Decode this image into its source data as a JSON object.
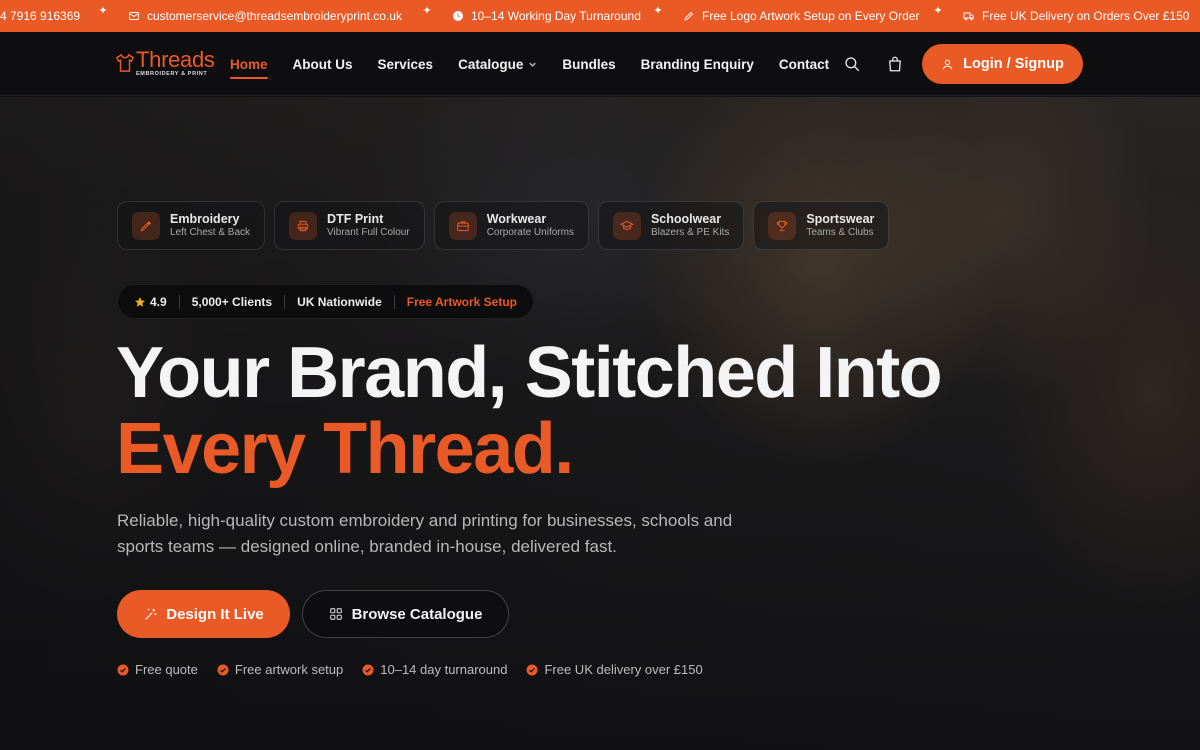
{
  "announcements": {
    "phone": "4 7916 916369",
    "email": "customerservice@threadsembroideryprint.co.uk",
    "turnaround": "10–14 Working Day Turnaround",
    "logo_setup": "Free Logo Artwork Setup on Every Order",
    "delivery": "Free UK Delivery on Orders Over £150",
    "sparkle": "✦"
  },
  "logo": {
    "main": "Threads",
    "sub": "EMBROIDERY & PRINT"
  },
  "nav": {
    "items": [
      {
        "label": "Home",
        "active": true
      },
      {
        "label": "About Us"
      },
      {
        "label": "Services"
      },
      {
        "label": "Catalogue",
        "has_dropdown": true
      },
      {
        "label": "Bundles"
      },
      {
        "label": "Branding Enquiry"
      },
      {
        "label": "Contact"
      }
    ],
    "login_label": "Login / Signup"
  },
  "services": [
    {
      "title": "Embroidery",
      "subtitle": "Left Chest & Back",
      "icon": "needle-icon"
    },
    {
      "title": "DTF Print",
      "subtitle": "Vibrant Full Colour",
      "icon": "printer-icon"
    },
    {
      "title": "Workwear",
      "subtitle": "Corporate Uniforms",
      "icon": "briefcase-icon"
    },
    {
      "title": "Schoolwear",
      "subtitle": "Blazers & PE Kits",
      "icon": "graduation-cap-icon"
    },
    {
      "title": "Sportswear",
      "subtitle": "Teams & Clubs",
      "icon": "trophy-icon"
    }
  ],
  "stats": {
    "rating": "4.9",
    "clients": "5,000+ Clients",
    "coverage": "UK Nationwide",
    "artwork": "Free Artwork Setup"
  },
  "hero": {
    "headline_line1": "Your Brand, Stitched Into",
    "headline_line2": "Every Thread.",
    "lead": "Reliable, high-quality custom embroidery and printing for businesses, schools and sports teams — designed online, branded in-house, delivered fast.",
    "primary_cta": "Design It Live",
    "secondary_cta": "Browse Catalogue"
  },
  "perks": [
    "Free quote",
    "Free artwork setup",
    "10–14 day turnaround",
    "Free UK delivery over £150"
  ],
  "colors": {
    "accent": "#ea5a26",
    "background": "#121214",
    "header_bg": "#0e0e10",
    "star": "#f3b41a"
  }
}
